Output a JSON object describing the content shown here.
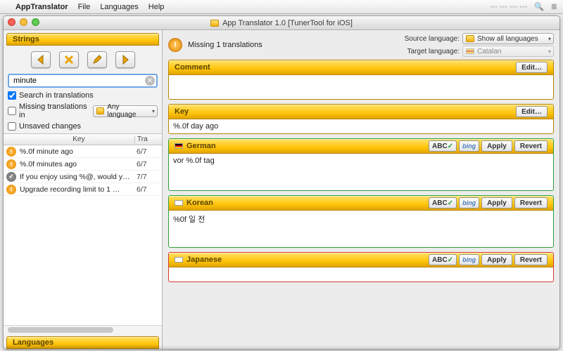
{
  "menubar": {
    "app": "AppTranslator",
    "items": [
      "File",
      "Languages",
      "Help"
    ]
  },
  "window": {
    "title": "App Translator 1.0 [TunerTool for iOS]"
  },
  "sidebar": {
    "strings_header": "Strings",
    "search_value": "minute",
    "checks": {
      "search_in_translations": {
        "label": "Search in translations",
        "checked": true
      },
      "missing_translations": {
        "label": "Missing translations in",
        "checked": false,
        "lang": "Any language"
      },
      "unsaved_changes": {
        "label": "Unsaved changes",
        "checked": false
      }
    },
    "columns": {
      "key": "Key",
      "tra": "Tra"
    },
    "rows": [
      {
        "status": "warn",
        "key": "%.0f minute ago",
        "count": "6/7"
      },
      {
        "status": "warn",
        "key": "%.0f minutes ago",
        "count": "6/7"
      },
      {
        "status": "ok",
        "key": "If you enjoy using %@, would y…",
        "count": "7/7"
      },
      {
        "status": "warn",
        "key": "Upgrade recording limit to 1 …",
        "count": "6/7"
      }
    ],
    "languages_header": "Languages"
  },
  "main": {
    "missing_text": "Missing 1 translations",
    "src_label": "Source language:",
    "src_value": "Show all languages",
    "tgt_label": "Target language:",
    "tgt_value": "Catalan",
    "edit_btn": "Edit…",
    "apply_btn": "Apply",
    "revert_btn": "Revert",
    "abc_btn": "ABC",
    "bing_btn": "bing",
    "comment": {
      "title": "Comment",
      "text": ""
    },
    "key": {
      "title": "Key",
      "text": "%.0f day ago"
    },
    "translations": [
      {
        "lang": "German",
        "flag": "de",
        "text": "vor %.0f tag",
        "border": "green"
      },
      {
        "lang": "Korean",
        "flag": "kr",
        "text": "%0f 일 전",
        "border": "green"
      },
      {
        "lang": "Japanese",
        "flag": "jp",
        "text": "",
        "border": "red"
      }
    ]
  }
}
